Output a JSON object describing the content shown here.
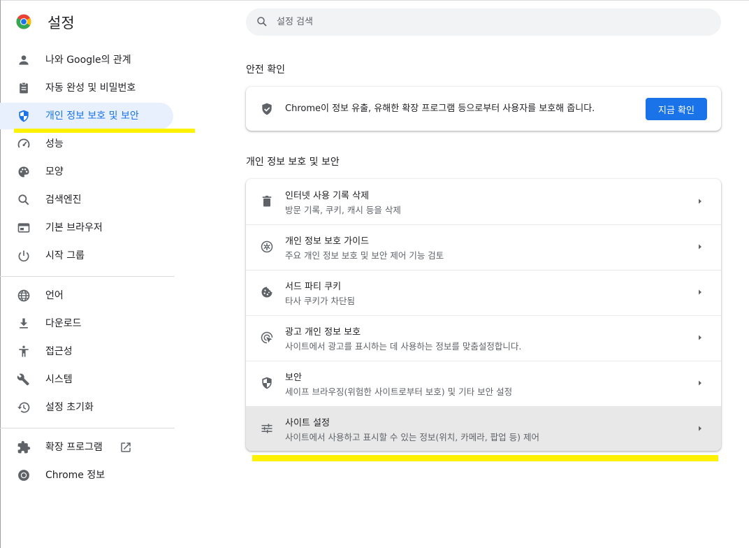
{
  "header": {
    "title": "설정",
    "search_placeholder": "설정 검색"
  },
  "sidebar": {
    "items": [
      {
        "label": "나와 Google의 관계",
        "icon": "person-icon"
      },
      {
        "label": "자동 완성 및 비밀번호",
        "icon": "clipboard-icon"
      },
      {
        "label": "개인 정보 보호 및 보안",
        "icon": "shield-icon",
        "active": true
      },
      {
        "label": "성능",
        "icon": "speedometer-icon"
      },
      {
        "label": "모양",
        "icon": "palette-icon"
      },
      {
        "label": "검색엔진",
        "icon": "search-icon"
      },
      {
        "label": "기본 브라우저",
        "icon": "browser-icon"
      },
      {
        "label": "시작 그룹",
        "icon": "power-icon"
      },
      {
        "label": "언어",
        "icon": "globe-icon"
      },
      {
        "label": "다운로드",
        "icon": "download-icon"
      },
      {
        "label": "접근성",
        "icon": "accessibility-icon"
      },
      {
        "label": "시스템",
        "icon": "wrench-icon"
      },
      {
        "label": "설정 초기화",
        "icon": "history-icon"
      },
      {
        "label": "확장 프로그램",
        "icon": "puzzle-icon"
      },
      {
        "label": "Chrome 정보",
        "icon": "chrome-icon"
      }
    ]
  },
  "safety_check": {
    "section_title": "안전 확인",
    "text": "Chrome이 정보 유출, 유해한 확장 프로그램 등으로부터 사용자를 보호해 줍니다.",
    "button": "지금 확인"
  },
  "privacy": {
    "section_title": "개인 정보 보호 및 보안",
    "rows": [
      {
        "title": "인터넷 사용 기록 삭제",
        "subtitle": "방문 기록, 쿠키, 캐시 등을 삭제",
        "icon": "trash-icon"
      },
      {
        "title": "개인 정보 보호 가이드",
        "subtitle": "주요 개인 정보 보호 및 보안 제어 기능 검토",
        "icon": "guide-icon"
      },
      {
        "title": "서드 파티 쿠키",
        "subtitle": "타사 쿠키가 차단됨",
        "icon": "cookie-icon"
      },
      {
        "title": "광고 개인 정보 보호",
        "subtitle": "사이트에서 광고를 표시하는 데 사용하는 정보를 맞춤설정합니다.",
        "icon": "ad-privacy-icon"
      },
      {
        "title": "보안",
        "subtitle": "세이프 브라우징(위험한 사이트로부터 보호) 및 기타 보안 설정",
        "icon": "security-shield-icon"
      },
      {
        "title": "사이트 설정",
        "subtitle": "사이트에서 사용하고 표시할 수 있는 정보(위치, 카메라, 팝업 등) 제어",
        "icon": "tune-icon"
      }
    ]
  },
  "colors": {
    "accent": "#1a73e8",
    "active_bg": "#e8f0fe",
    "highlight": "#fff200",
    "icon": "#5f6368"
  }
}
